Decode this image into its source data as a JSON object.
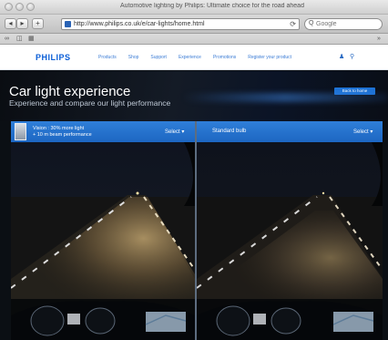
{
  "browser": {
    "window_title": "Automotive lighting by Philips: Ultimate choice for the road ahead",
    "url": "http://www.philips.co.uk/e/car-lights/home.html",
    "search_placeholder": "Google",
    "reload_icon": "reload-icon",
    "back_icon": "back-icon",
    "forward_icon": "forward-icon",
    "add_icon": "add-bookmark-icon"
  },
  "site": {
    "logo": "PHILIPS",
    "nav": [
      "Products",
      "Shop",
      "Support",
      "Experience",
      "Promotions",
      "Register your product"
    ],
    "brand_color": "#0b5ed7"
  },
  "hero": {
    "title": "Car light experience",
    "subtitle": "Experience and compare our light performance",
    "back_button": "Back to home"
  },
  "comparison": {
    "left": {
      "line1": "Vision : 30% more light",
      "line2": "+ 10 m beam performance",
      "select_label": "Select ▾"
    },
    "right": {
      "label": "Standard bulb",
      "select_label": "Select ▾"
    }
  }
}
